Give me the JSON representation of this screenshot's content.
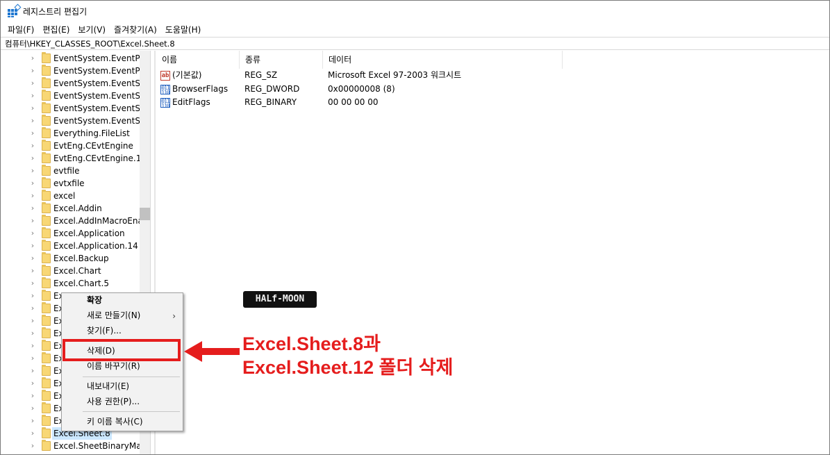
{
  "window": {
    "title": "레지스트리 편집기"
  },
  "menu": [
    "파일(F)",
    "편집(E)",
    "보기(V)",
    "즐겨찾기(A)",
    "도움말(H)"
  ],
  "address": "컴퓨터\\HKEY_CLASSES_ROOT\\Excel.Sheet.8",
  "tree": [
    "EventSystem.EventPubl",
    "EventSystem.EventPubl",
    "EventSystem.EventSubs",
    "EventSystem.EventSubs",
    "EventSystem.EventSyst",
    "EventSystem.EventSyst",
    "Everything.FileList",
    "EvtEng.CEvtEngine",
    "EvtEng.CEvtEngine.1",
    "evtfile",
    "evtxfile",
    "excel",
    "Excel.Addin",
    "Excel.AddInMacroEnab",
    "Excel.Application",
    "Excel.Application.14",
    "Excel.Backup",
    "Excel.Chart",
    "Excel.Chart.5",
    "Ex",
    "Ex",
    "Ex",
    "Ex",
    "Ex",
    "Ex",
    "Ex",
    "Ex",
    "Ex",
    "Ex",
    "Ex",
    "Excel.Sheet.8",
    "Excel.SheetBinaryMacro"
  ],
  "tree_selected_index": 30,
  "list": {
    "columns": [
      "이름",
      "종류",
      "데이터"
    ],
    "rows": [
      {
        "icon": "string-value-icon",
        "name": "(기본값)",
        "type": "REG_SZ",
        "data": "Microsoft Excel 97-2003 워크시트"
      },
      {
        "icon": "binary-value-icon",
        "name": "BrowserFlags",
        "type": "REG_DWORD",
        "data": "0x00000008 (8)"
      },
      {
        "icon": "binary-value-icon",
        "name": "EditFlags",
        "type": "REG_BINARY",
        "data": "00 00 00 00"
      }
    ]
  },
  "watermark": "HALf-MOON",
  "context_menu": {
    "items": [
      "확장",
      "새로 만들기(N)",
      "찾기(F)...",
      "삭제(D)",
      "이름 바꾸기(R)",
      "내보내기(E)",
      "사용 권한(P)...",
      "키 이름 복사(C)"
    ],
    "submenu_arrow": "›"
  },
  "annotation": {
    "line1": "Excel.Sheet.8과",
    "line2": "Excel.Sheet.12 폴더 삭제",
    "color": "#e51d1d"
  },
  "icons": {
    "folder": "folder-icon",
    "chevron": "›",
    "ab": "ab",
    "bin": "011 110"
  }
}
